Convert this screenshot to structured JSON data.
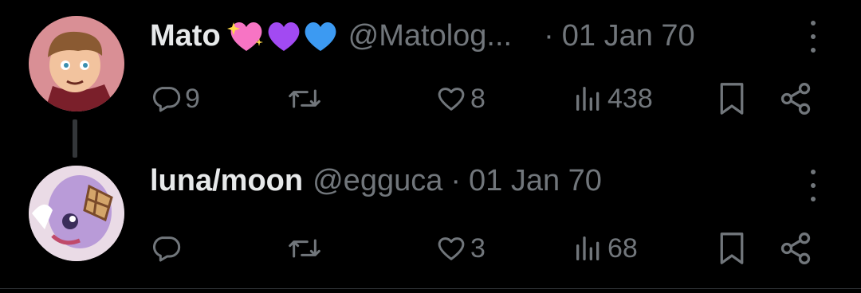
{
  "tweets": [
    {
      "name": "Mato",
      "emojis": [
        "sparkling-heart",
        "purple-heart",
        "blue-heart"
      ],
      "handle": "@Matolog...",
      "separator": "·",
      "time": "01 Jan 70",
      "replies": "9",
      "retweets": "",
      "likes": "8",
      "views": "438"
    },
    {
      "name": "luna/moon",
      "handle": "@egguca",
      "separator": "·",
      "time": "01 Jan 70",
      "replies": "",
      "retweets": "",
      "likes": "3",
      "views": "68"
    }
  ],
  "colors": {
    "background": "#000000",
    "text": "#e7e9ea",
    "muted": "#71767b",
    "thread_line": "#333639"
  },
  "icons": [
    "reply-icon",
    "retweet-icon",
    "like-icon",
    "views-icon",
    "bookmark-icon",
    "share-icon",
    "more-icon"
  ]
}
